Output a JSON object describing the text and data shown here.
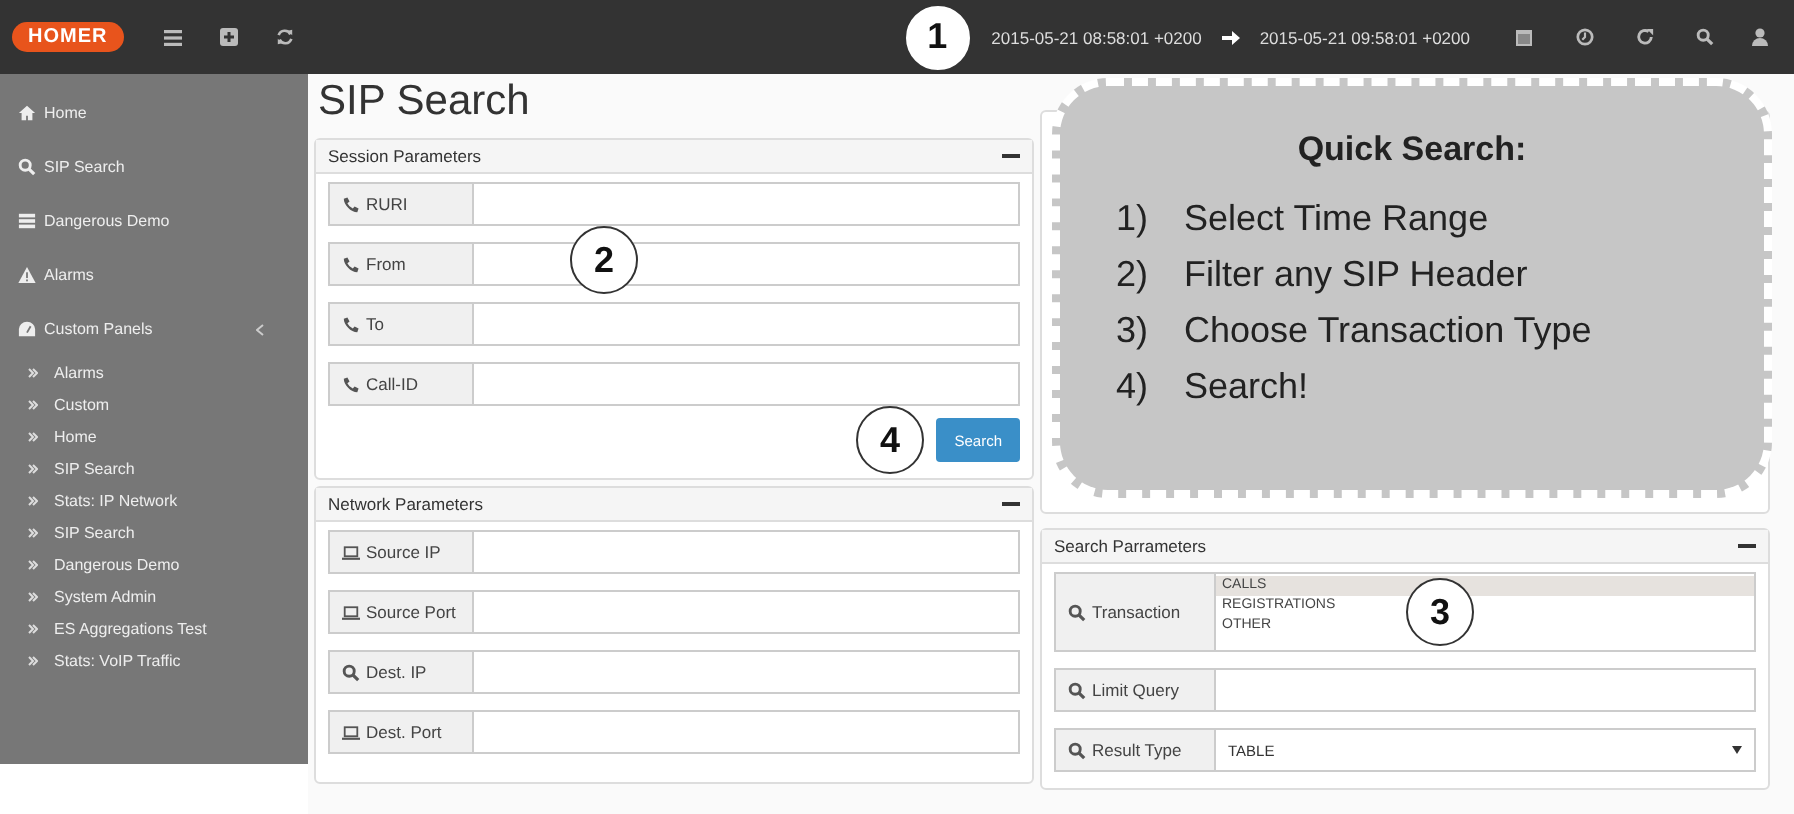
{
  "topbar": {
    "logo": "HOMER",
    "callout": "1",
    "time_from": "2015-05-21 08:58:01 +0200",
    "time_to": "2015-05-21 09:58:01 +0200"
  },
  "sidebar": {
    "items": [
      {
        "label": "Home",
        "kind": "home"
      },
      {
        "label": "SIP Search",
        "kind": "search"
      },
      {
        "label": "Dangerous Demo",
        "kind": "list"
      },
      {
        "label": "Alarms",
        "kind": "warning"
      },
      {
        "label": "Custom Panels",
        "kind": "panels",
        "expanded": true,
        "children": [
          {
            "label": "Alarms"
          },
          {
            "label": "Custom"
          },
          {
            "label": "Home"
          },
          {
            "label": "SIP Search"
          },
          {
            "label": "Stats: IP Network"
          },
          {
            "label": "SIP Search"
          },
          {
            "label": "Dangerous Demo"
          },
          {
            "label": "System Admin"
          },
          {
            "label": "ES Aggregations Test"
          },
          {
            "label": "Stats: VoIP Traffic"
          }
        ]
      }
    ]
  },
  "page_title": "SIP Search",
  "session_panel": {
    "title": "Session Parameters",
    "callout": "2",
    "fields": [
      {
        "label": "RURI",
        "kind": "phone"
      },
      {
        "label": "From",
        "kind": "phone"
      },
      {
        "label": "To",
        "kind": "phone"
      },
      {
        "label": "Call-ID",
        "kind": "phone"
      }
    ],
    "button": "Search",
    "button_callout": "4"
  },
  "network_panel": {
    "title": "Network Parameters",
    "fields": [
      {
        "label": "Source IP",
        "kind": "laptop"
      },
      {
        "label": "Source Port",
        "kind": "laptop"
      },
      {
        "label": "Dest. IP",
        "kind": "search"
      },
      {
        "label": "Dest. Port",
        "kind": "laptop"
      }
    ]
  },
  "quick_search": {
    "title": "Quick Search:",
    "steps": [
      {
        "number": "1)",
        "text": "Select Time Range"
      },
      {
        "number": "2)",
        "text": "Filter any SIP Header"
      },
      {
        "number": "3)",
        "text": "Choose Transaction Type"
      },
      {
        "number": "4)",
        "text": "Search!"
      }
    ]
  },
  "search_panel": {
    "title": "Search Parrameters",
    "callout": "3",
    "transaction": {
      "label": "Transaction",
      "options": [
        {
          "label": "CALLS",
          "selected": true
        },
        {
          "label": "REGISTRATIONS",
          "selected": false
        },
        {
          "label": "OTHER",
          "selected": false
        }
      ]
    },
    "limit_query": {
      "label": "Limit Query"
    },
    "result_type": {
      "label": "Result Type",
      "value": "TABLE"
    }
  }
}
